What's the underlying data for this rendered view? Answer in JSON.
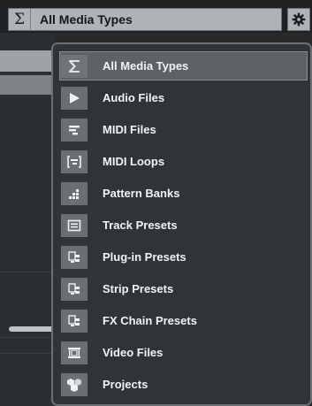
{
  "header": {
    "sigma_symbol": "Σ",
    "selected_media_type": "All Media Types",
    "settings_icon": "gear-icon"
  },
  "menu": {
    "items": [
      {
        "label": "All Media Types",
        "icon": "sigma-icon",
        "selected": true
      },
      {
        "label": "Audio Files",
        "icon": "play-icon",
        "selected": false
      },
      {
        "label": "MIDI Files",
        "icon": "midi-bars-icon",
        "selected": false
      },
      {
        "label": "MIDI Loops",
        "icon": "midi-loop-icon",
        "selected": false
      },
      {
        "label": "Pattern Banks",
        "icon": "pattern-steps-icon",
        "selected": false
      },
      {
        "label": "Track Presets",
        "icon": "track-preset-icon",
        "selected": false
      },
      {
        "label": "Plug-in Presets",
        "icon": "plugin-preset-icon",
        "selected": false
      },
      {
        "label": "Strip Presets",
        "icon": "plugin-preset-icon",
        "selected": false
      },
      {
        "label": "FX Chain Presets",
        "icon": "plugin-preset-icon",
        "selected": false
      },
      {
        "label": "Video Files",
        "icon": "film-icon",
        "selected": false
      },
      {
        "label": "Projects",
        "icon": "cubes-icon",
        "selected": false
      }
    ]
  },
  "colors": {
    "menu_background": "#313437",
    "menu_border": "#6b7073",
    "selected_row": "#5c6265",
    "icon_tile": "#6a6f72",
    "text": "#f2f3f4"
  }
}
